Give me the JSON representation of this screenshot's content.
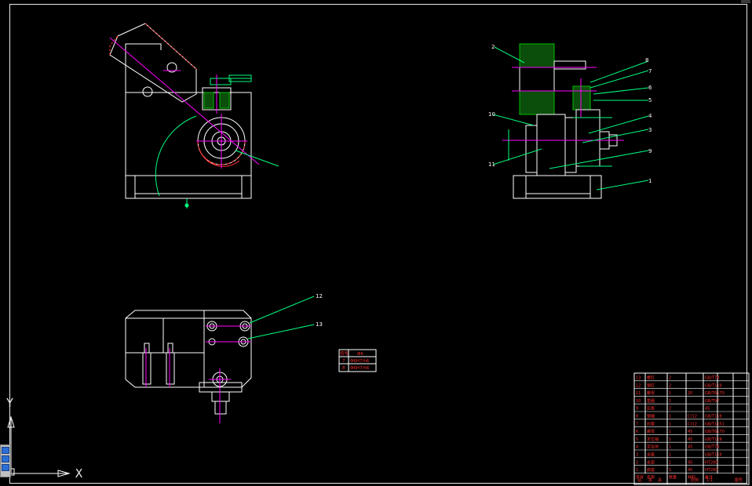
{
  "ucs": {
    "y_label": "Y",
    "x_label": "X"
  },
  "colors": {
    "background": "#000000",
    "lines": "#ffffff",
    "leaders": "#00ff7f",
    "centerlines": "#ff00ff",
    "hatch": "#00c000",
    "dims": "#ff3030"
  },
  "balloons": {
    "side_view": [
      "1",
      "2",
      "3",
      "4",
      "5",
      "6",
      "7",
      "8",
      "9",
      "10",
      "11"
    ],
    "plan_view": [
      "12",
      "13"
    ]
  },
  "dim_note": "Φ6",
  "tolerance_table": {
    "header": [
      "符号",
      "Φ6"
    ],
    "rows": [
      [
        "7",
        "Φ6H7/h6"
      ],
      [
        "8",
        "Φ6H7/h6"
      ]
    ]
  },
  "title_block": {
    "rows": [
      [
        "13",
        "螺钉",
        "2",
        "",
        "GB/T70"
      ],
      [
        "12",
        "销钉",
        "2",
        "",
        "GB/T119"
      ],
      [
        "11",
        "螺母",
        "1",
        "20",
        "GB/T6170"
      ],
      [
        "10",
        "垫圈",
        "1",
        "",
        "GB/T97"
      ],
      [
        "9",
        "压板",
        "2",
        "",
        "45"
      ],
      [
        "8",
        "销轴",
        "1",
        "Cr12",
        "GB/T119"
      ],
      [
        "7",
        "衬套",
        "1",
        "Cr12",
        "GB/T1151"
      ],
      [
        "6",
        "螺母",
        "1",
        "45",
        "GB/T6170"
      ],
      [
        "5",
        "定位销",
        "1",
        "45",
        "GB/T119"
      ],
      [
        "4",
        "定位块",
        "1",
        "45",
        "GB/T70"
      ],
      [
        "3",
        "支座",
        "1",
        "",
        "GB/T119"
      ],
      [
        "2",
        "支架",
        "1",
        "45",
        "HT200"
      ],
      [
        "1",
        "底座",
        "1",
        "45",
        "HT200"
      ]
    ],
    "header": [
      "序号",
      "名称",
      "数量",
      "材料",
      "备注"
    ],
    "footer": [
      "钻",
      "夹",
      "具",
      "比例",
      "1:1",
      "图号"
    ]
  }
}
